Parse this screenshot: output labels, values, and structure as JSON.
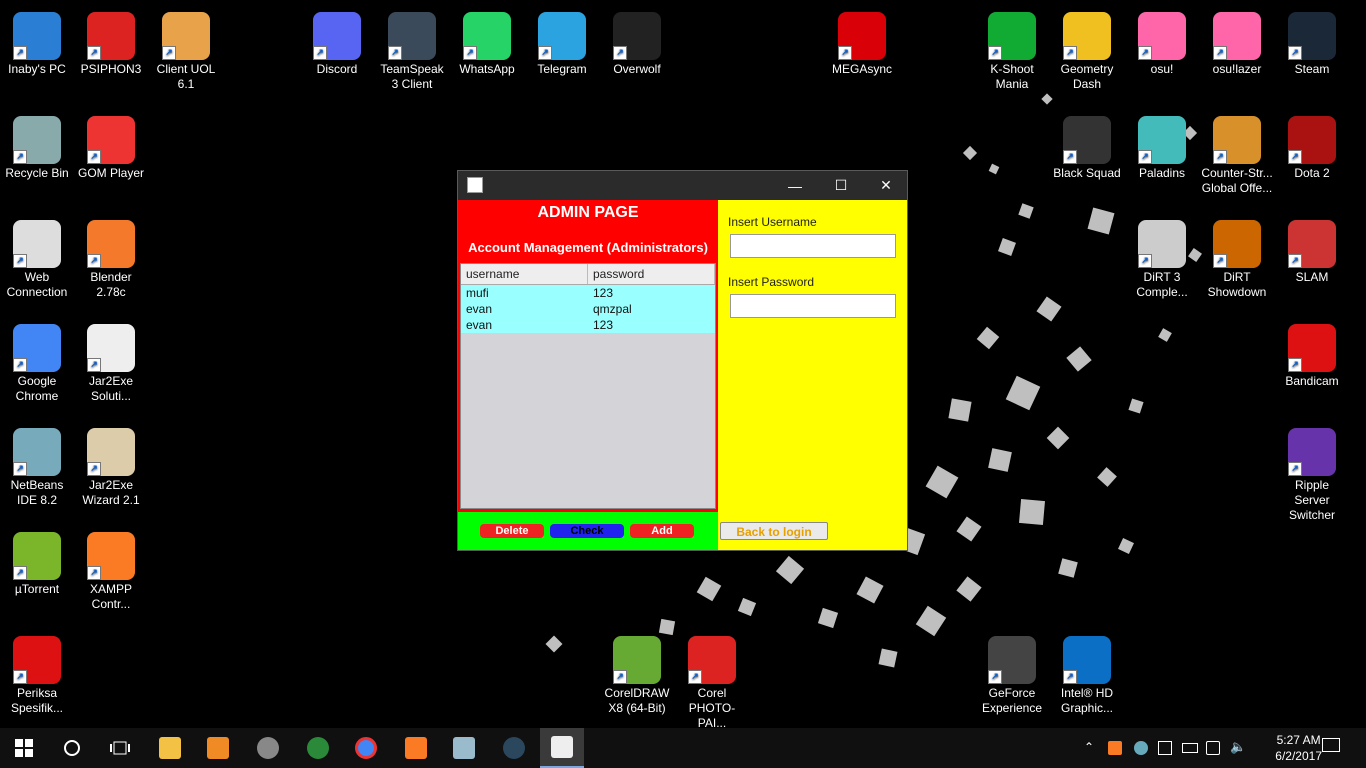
{
  "desktop_icons": [
    {
      "label": "Inaby's PC",
      "color": "#2a7fd4"
    },
    {
      "label": "PSIPHON3",
      "color": "#d22"
    },
    {
      "label": "Client UOL 6.1",
      "color": "#e8a24a"
    },
    {
      "label": "Discord",
      "color": "#5865f2"
    },
    {
      "label": "TeamSpeak 3 Client",
      "color": "#3a4a5a"
    },
    {
      "label": "WhatsApp",
      "color": "#25d366"
    },
    {
      "label": "Telegram",
      "color": "#2aa3e0"
    },
    {
      "label": "Overwolf",
      "color": "#222"
    },
    {
      "label": "MEGAsync",
      "color": "#d90007"
    },
    {
      "label": "K-Shoot Mania",
      "color": "#1a3"
    },
    {
      "label": "Geometry Dash",
      "color": "#f0c020"
    },
    {
      "label": "osu!",
      "color": "#ff66aa"
    },
    {
      "label": "osu!lazer",
      "color": "#ff66aa"
    },
    {
      "label": "Steam",
      "color": "#1b2838"
    },
    {
      "label": "Recycle Bin",
      "color": "#8aa"
    },
    {
      "label": "GOM Player",
      "color": "#e33"
    },
    {
      "label": "Black Squad",
      "color": "#333"
    },
    {
      "label": "Paladins",
      "color": "#4bb"
    },
    {
      "label": "Counter-Str... Global Offe...",
      "color": "#d8902a"
    },
    {
      "label": "Dota 2",
      "color": "#a11"
    },
    {
      "label": "Web Connection",
      "color": "#ddd"
    },
    {
      "label": "Blender 2.78c",
      "color": "#f5792a"
    },
    {
      "label": "DiRT 3 Comple...",
      "color": "#ccc"
    },
    {
      "label": "DiRT Showdown",
      "color": "#c60"
    },
    {
      "label": "SLAM",
      "color": "#c33"
    },
    {
      "label": "Google Chrome",
      "color": "#4285f4"
    },
    {
      "label": "Jar2Exe Soluti...",
      "color": "#eee"
    },
    {
      "label": "Bandicam",
      "color": "#d11"
    },
    {
      "label": "NetBeans IDE 8.2",
      "color": "#7ab"
    },
    {
      "label": "Jar2Exe Wizard 2.1",
      "color": "#dca"
    },
    {
      "label": "Ripple Server Switcher",
      "color": "#63a"
    },
    {
      "label": "µTorrent",
      "color": "#7bb529"
    },
    {
      "label": "XAMPP Contr...",
      "color": "#fb7a24"
    },
    {
      "label": "Periksa Spesifik...",
      "color": "#d11"
    },
    {
      "label": "CorelDRAW X8 (64-Bit)",
      "color": "#6a3"
    },
    {
      "label": "Corel PHOTO-PAI...",
      "color": "#d22"
    },
    {
      "label": "GeForce Experience",
      "color": "#444"
    },
    {
      "label": "Intel® HD Graphic...",
      "color": "#0b6fc6"
    }
  ],
  "window": {
    "admin_title": "ADMIN PAGE",
    "admin_subtitle": "Account Management (Administrators)",
    "columns": [
      "username",
      "password"
    ],
    "rows": [
      [
        "mufi",
        "123"
      ],
      [
        "evan",
        "qmzpal"
      ],
      [
        "evan",
        "123"
      ]
    ],
    "username_label": "Insert Username",
    "password_label": "Insert Password",
    "delete_label": "Delete",
    "check_label": "Check",
    "add_label": "Add",
    "back_label": "Back to login",
    "minimize": "—",
    "maximize": "☐",
    "close": "✕"
  },
  "taskbar": {
    "time": "5:27 AM",
    "date": "6/2/2017"
  }
}
